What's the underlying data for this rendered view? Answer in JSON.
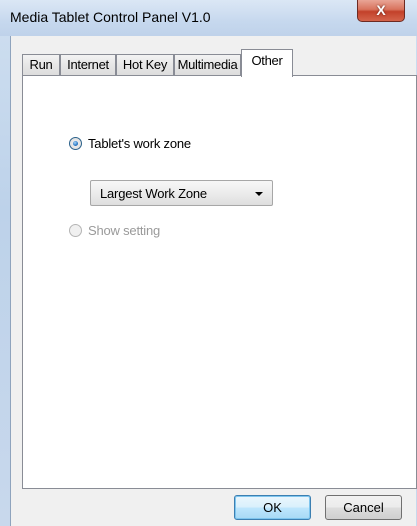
{
  "window": {
    "title": "Media Tablet Control Panel V1.0",
    "close_glyph": "X"
  },
  "tabs": [
    {
      "label": "Run"
    },
    {
      "label": "Internet"
    },
    {
      "label": "Hot Key"
    },
    {
      "label": "Multimedia"
    },
    {
      "label": "Other"
    }
  ],
  "active_tab": "Other",
  "other": {
    "work_zone_label": "Tablet's work zone",
    "work_zone_selected": true,
    "work_zone_value": "Largest Work Zone",
    "show_setting_label": "Show setting",
    "show_setting_enabled": false
  },
  "buttons": {
    "ok": "OK",
    "cancel": "Cancel"
  },
  "colors": {
    "accent": "#3c7fb1",
    "close": "#c2412a"
  }
}
